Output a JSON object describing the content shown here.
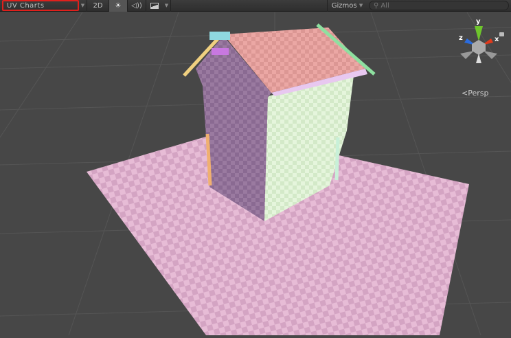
{
  "toolbar": {
    "draw_mode": "UV Charts",
    "btn_2d": "2D",
    "lighting_icon": "sun-icon",
    "audio_icon": "speaker-icon",
    "effects_icon": "image-icon",
    "gizmos": "Gizmos",
    "search_placeholder": "All"
  },
  "gizmo": {
    "x": "x",
    "y": "y",
    "z": "z",
    "projection": "Persp"
  },
  "colors": {
    "highlight": "#e0201c",
    "background": "#474747"
  }
}
